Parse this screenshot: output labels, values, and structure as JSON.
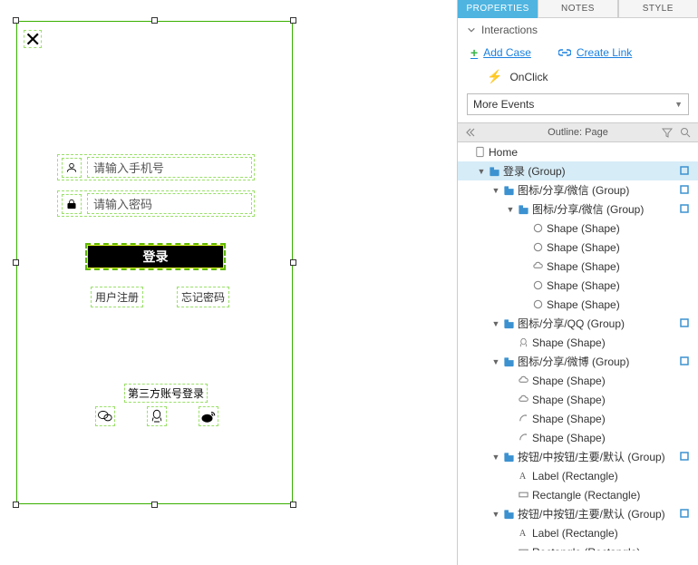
{
  "canvas": {
    "close": "✕",
    "phone_placeholder": "请输入手机号",
    "password_placeholder": "请输入密码",
    "login_button": "登录",
    "register_link": "用户注册",
    "forgot_link": "忘记密码",
    "third_party_label": "第三方账号登录"
  },
  "tabs": {
    "properties": "PROPERTIES",
    "notes": "NOTES",
    "style": "STYLE"
  },
  "panel": {
    "interactions_label": "Interactions",
    "add_case": "Add Case",
    "create_link": "Create Link",
    "onclick": "OnClick",
    "more_events": "More Events"
  },
  "outline": {
    "title": "Outline: Page",
    "rows": [
      {
        "ind": 0,
        "disc": "",
        "icon": "page",
        "label": "Home",
        "note": false
      },
      {
        "ind": 1,
        "disc": "down",
        "icon": "folder",
        "label": "登录 (Group)",
        "note": true,
        "sel": true
      },
      {
        "ind": 2,
        "disc": "down",
        "icon": "folder",
        "label": "图标/分享/微信 (Group)",
        "note": true
      },
      {
        "ind": 3,
        "disc": "down",
        "icon": "folder",
        "label": "图标/分享/微信 (Group)",
        "note": true
      },
      {
        "ind": 4,
        "disc": "",
        "icon": "circle",
        "label": "Shape (Shape)",
        "note": false
      },
      {
        "ind": 4,
        "disc": "",
        "icon": "circle",
        "label": "Shape (Shape)",
        "note": false
      },
      {
        "ind": 4,
        "disc": "",
        "icon": "cloud",
        "label": "Shape (Shape)",
        "note": false
      },
      {
        "ind": 4,
        "disc": "",
        "icon": "circle",
        "label": "Shape (Shape)",
        "note": false
      },
      {
        "ind": 4,
        "disc": "",
        "icon": "circle",
        "label": "Shape (Shape)",
        "note": false
      },
      {
        "ind": 2,
        "disc": "down",
        "icon": "folder",
        "label": "图标/分享/QQ (Group)",
        "note": true
      },
      {
        "ind": 3,
        "disc": "",
        "icon": "penguin",
        "label": "Shape (Shape)",
        "note": false
      },
      {
        "ind": 2,
        "disc": "down",
        "icon": "folder",
        "label": "图标/分享/微博 (Group)",
        "note": true
      },
      {
        "ind": 3,
        "disc": "",
        "icon": "cloud",
        "label": "Shape (Shape)",
        "note": false
      },
      {
        "ind": 3,
        "disc": "",
        "icon": "cloud",
        "label": "Shape (Shape)",
        "note": false
      },
      {
        "ind": 3,
        "disc": "",
        "icon": "curve",
        "label": "Shape (Shape)",
        "note": false
      },
      {
        "ind": 3,
        "disc": "",
        "icon": "curve",
        "label": "Shape (Shape)",
        "note": false
      },
      {
        "ind": 2,
        "disc": "down",
        "icon": "folder",
        "label": "按钮/中按钮/主要/默认 (Group)",
        "note": true
      },
      {
        "ind": 3,
        "disc": "",
        "icon": "text",
        "label": "Label (Rectangle)",
        "note": false
      },
      {
        "ind": 3,
        "disc": "",
        "icon": "rect",
        "label": "Rectangle  (Rectangle)",
        "note": false
      },
      {
        "ind": 2,
        "disc": "down",
        "icon": "folder",
        "label": "按钮/中按钮/主要/默认 (Group)",
        "note": true
      },
      {
        "ind": 3,
        "disc": "",
        "icon": "text",
        "label": "Label (Rectangle)",
        "note": false
      },
      {
        "ind": 3,
        "disc": "",
        "icon": "rect",
        "label": "Rectangle  (Rectangle)",
        "note": false
      }
    ]
  }
}
